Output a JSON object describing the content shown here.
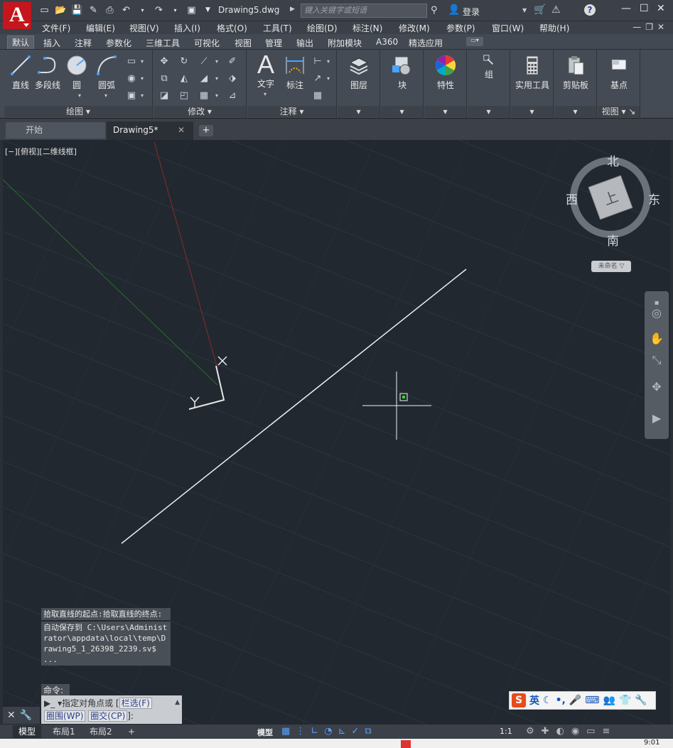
{
  "app": {
    "logo_letter": "A",
    "document_title": "Drawing5.dwg",
    "search_placeholder": "键入关键字或短语",
    "login_label": "登录"
  },
  "menu": [
    "文件(F)",
    "编辑(E)",
    "视图(V)",
    "插入(I)",
    "格式(O)",
    "工具(T)",
    "绘图(D)",
    "标注(N)",
    "修改(M)",
    "参数(P)",
    "窗口(W)",
    "帮助(H)"
  ],
  "ribbon_tabs": [
    "默认",
    "插入",
    "注释",
    "参数化",
    "三维工具",
    "可视化",
    "视图",
    "管理",
    "输出",
    "附加模块",
    "A360",
    "精选应用"
  ],
  "ribbon": {
    "draw": {
      "title": "绘图",
      "line": "直线",
      "polyline": "多段线",
      "circle": "圆",
      "arc": "圆弧"
    },
    "modify": {
      "title": "修改"
    },
    "annotation": {
      "title": "注释",
      "text": "文字",
      "dimension": "标注"
    },
    "layers": "图层",
    "block": "块",
    "properties": "特性",
    "groups": "组",
    "utilities": "实用工具",
    "clipboard": "剪贴板",
    "view": {
      "title": "视图",
      "base": "基点"
    }
  },
  "file_tabs": {
    "start": "开始",
    "drawing": "Drawing5*",
    "close_glyph": "✕",
    "add_glyph": "+"
  },
  "viewport": {
    "label": "[−][俯视][二维线框]"
  },
  "viewcube": {
    "north": "北",
    "south": "南",
    "east": "东",
    "west": "西",
    "face_label": "上",
    "ucs_name": "未命名"
  },
  "command": {
    "history": [
      "拾取直线的起点:拾取直线的终点:",
      "自动保存到 C:\\Users\\Administrator\\appdata\\local\\temp\\Drawing5_1_26398_2239.sv$ ..."
    ],
    "prompt": "命令:",
    "input_text": "▾指定对角点或",
    "kw_fence": "栏选(F)",
    "kw_wpoly": "圈围(WP)",
    "kw_cpoly": "圈交(CP)",
    "input_tail": "]:"
  },
  "status": {
    "tabs": [
      "模型",
      "布局1",
      "布局2"
    ],
    "add_glyph": "+",
    "mode": "模型",
    "scale": "1:1"
  },
  "ime": {
    "logo": "S",
    "lang": "英"
  },
  "taskbar": {
    "clock": "9:01"
  },
  "colors": {
    "canvas_bg": "#212830",
    "ucs_x_axis": "#8b2a2a",
    "ucs_y_axis": "#2c6b2c",
    "accent_red": "#c4161c"
  }
}
